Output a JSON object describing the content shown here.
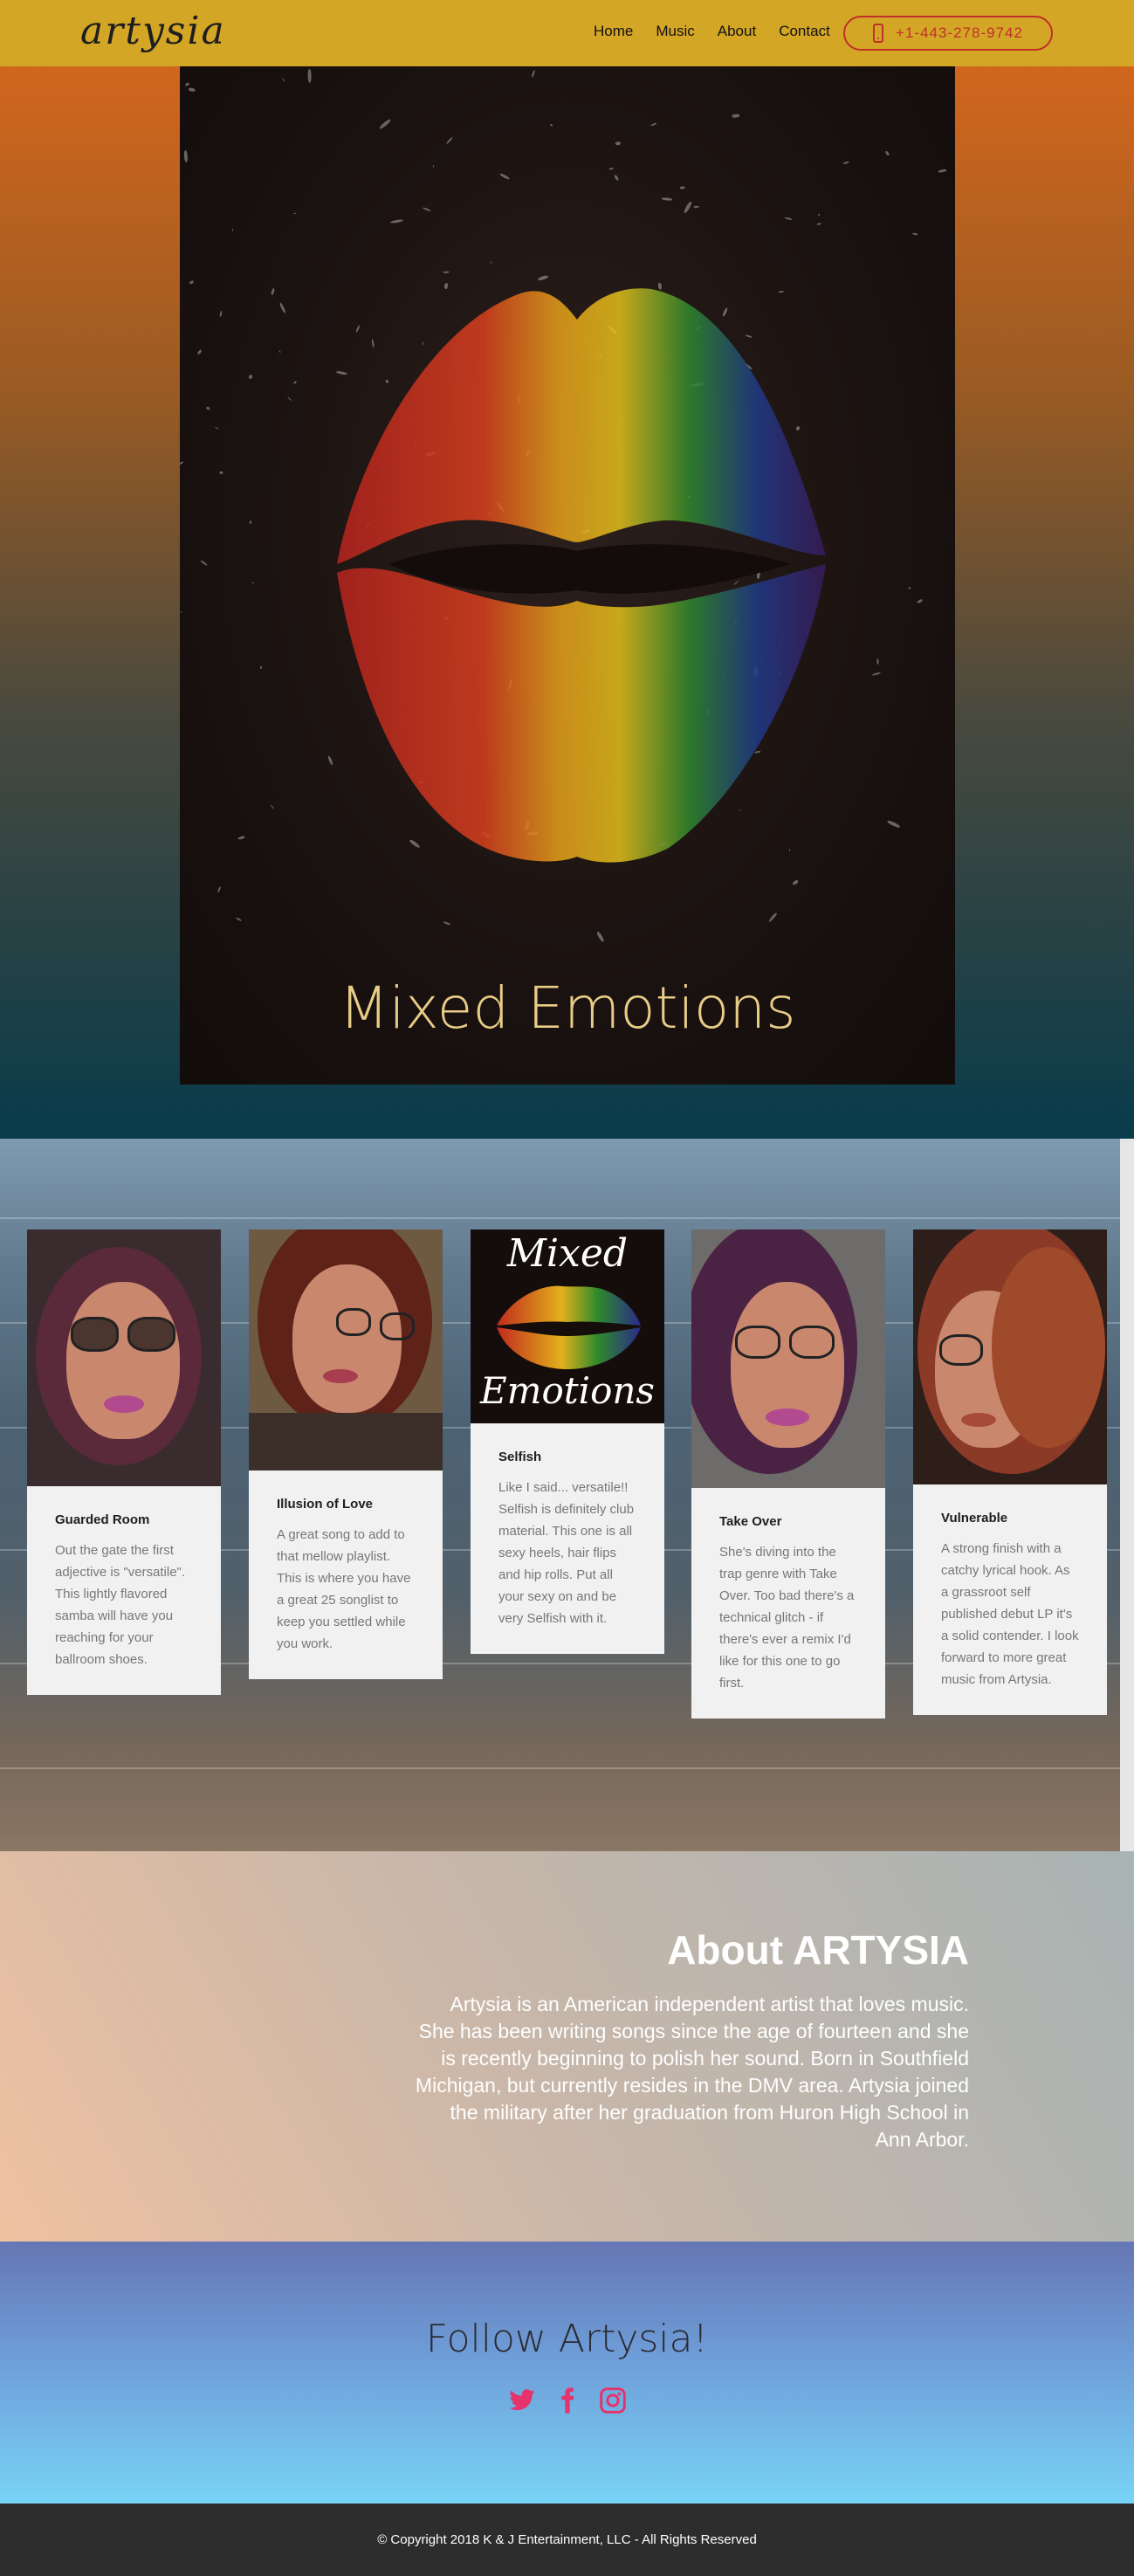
{
  "brand": {
    "logo": "artysia"
  },
  "nav": {
    "items": [
      {
        "label": "Home"
      },
      {
        "label": "Music"
      },
      {
        "label": "About"
      },
      {
        "label": "Contact"
      }
    ],
    "phone": "+1-443-278-9742"
  },
  "hero": {
    "album_title": "Mixed Emotions"
  },
  "songs": [
    {
      "title": "Guarded Room",
      "description": "Out the gate the first adjective is \"versatile\". This lightly flavored samba will have you reaching for your ballroom shoes."
    },
    {
      "title": "Illusion of Love",
      "description": "A great song to add to that mellow playlist.  This is where you have a great 25 songlist to keep you settled while you work."
    },
    {
      "title": "Selfish",
      "description": "Like I said... versatile!!  Selfish is definitely club material.  This one is all sexy heels, hair flips and hip rolls.  Put all your sexy on and be very Selfish with it.",
      "cover_top": "Mixed",
      "cover_bottom": "Emotions"
    },
    {
      "title": "Take Over",
      "description": "She's diving into the trap genre with Take Over.  Too bad there's a technical glitch - if there's ever a remix I'd like for this one to go first."
    },
    {
      "title": "Vulnerable",
      "description": "A strong finish with a catchy lyrical hook.  As a grassroot self published debut LP it's a solid contender.  I look forward to more great music from Artysia."
    }
  ],
  "about": {
    "heading": "About ARTYSIA",
    "body": "Artysia is an American independent artist that loves music. She has been writing songs since the age of fourteen and she is recently beginning to polish her sound. Born in Southfield Michigan, but currently resides in the DMV area. Artysia joined the military after her graduation from Huron High School in Ann Arbor."
  },
  "follow": {
    "heading": "Follow Artysia!",
    "icons": [
      "twitter-icon",
      "facebook-icon",
      "instagram-icon"
    ],
    "icon_color": "#e5336b"
  },
  "footer": {
    "copyright": "© Copyright 2018 K & J Entertainment, LLC - All Rights Reserved"
  }
}
